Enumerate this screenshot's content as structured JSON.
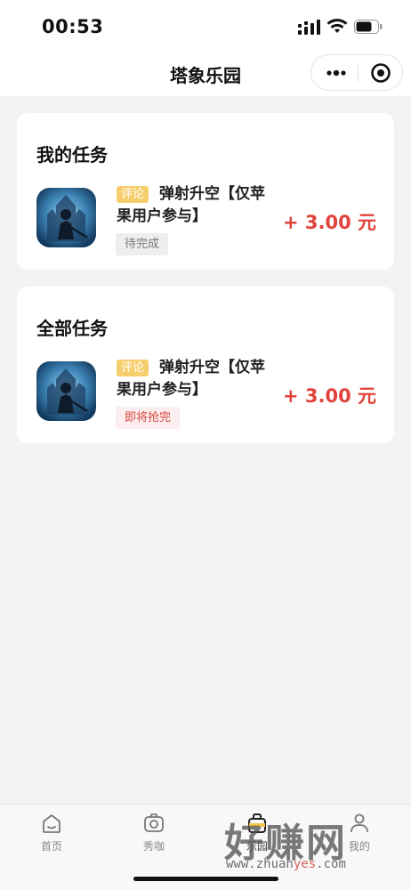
{
  "status_bar": {
    "time": "00:53",
    "icons": [
      "cellular-signal-icon",
      "wifi-icon",
      "battery-icon"
    ]
  },
  "nav": {
    "title": "塔象乐园",
    "capsule": [
      "more-icon",
      "close-mini-program-icon"
    ]
  },
  "sections": [
    {
      "title": "我的任务",
      "task": {
        "tag": "评论",
        "title": "弹射升空【仅苹果用户参与】",
        "status": "待完成",
        "reward": "+ 3.00 元"
      }
    },
    {
      "title": "全部任务",
      "task": {
        "tag": "评论",
        "title": "弹射升空【仅苹果用户参与】",
        "status": "即将抢完",
        "reward": "+ 3.00 元"
      }
    }
  ],
  "tabbar": {
    "items": [
      {
        "label": "首页",
        "icon": "home-icon"
      },
      {
        "label": "秀咖",
        "icon": "camera-icon"
      },
      {
        "label": "乐园",
        "icon": "briefcase-icon"
      },
      {
        "label": "我的",
        "icon": "profile-icon"
      }
    ]
  },
  "watermark": {
    "main": "好赚网",
    "url_prefix": "www.zhuan",
    "url_highlight": "yes",
    "url_suffix": ".com"
  },
  "colors": {
    "accent_red": "#e0433a",
    "tag_yellow": "#f6cf6c",
    "page_bg": "#f3f3f3"
  }
}
